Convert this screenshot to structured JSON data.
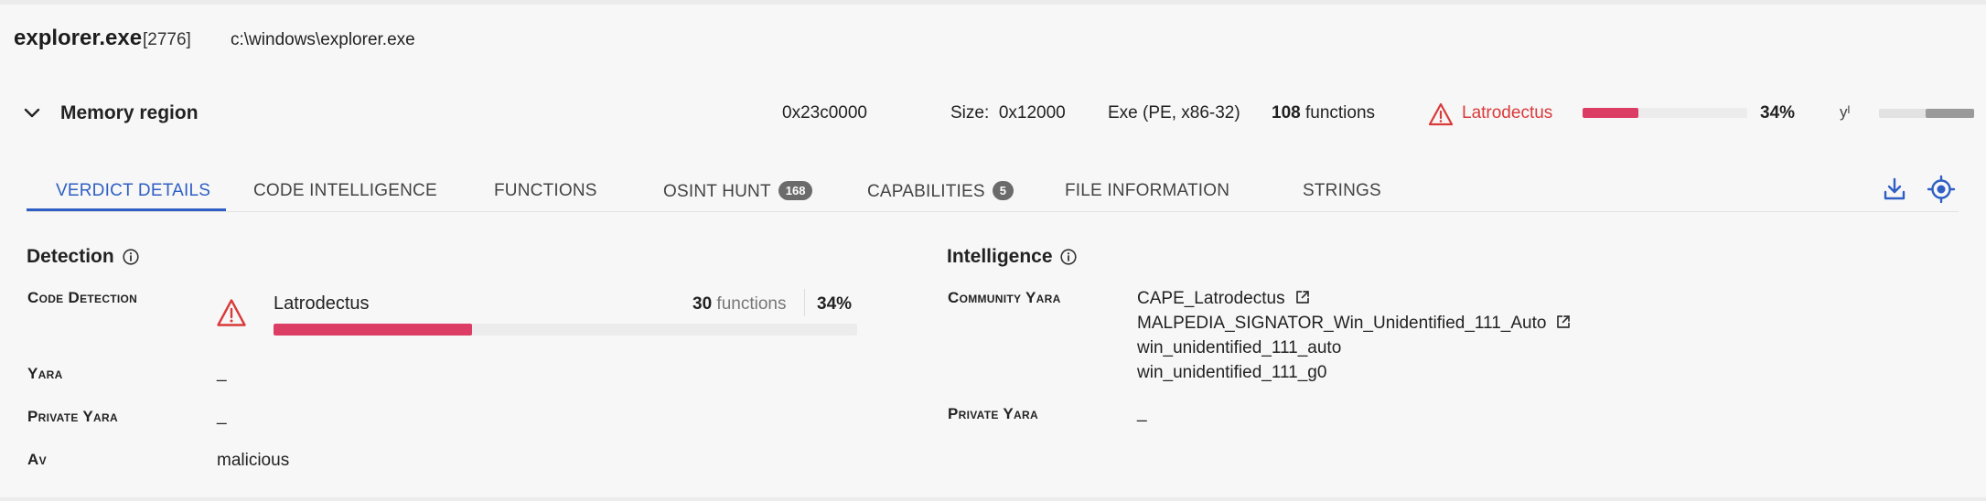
{
  "process": {
    "name": "explorer.exe",
    "pid": "[2776]",
    "path": "c:\\windows\\explorer.exe"
  },
  "memory_region": {
    "title": "Memory region",
    "address": "0x23c0000",
    "size_label": "Size:",
    "size_value": "0x12000",
    "type": "Exe (PE, x86-32)",
    "functions_count": "108",
    "functions_label": "functions",
    "family": "Latrodectus",
    "match_percent_label": "34%",
    "match_fraction": 0.34,
    "entropy_symbol": "yᴵ",
    "entropy_fraction": 0.51
  },
  "tabs": [
    {
      "label": "VERDICT DETAILS",
      "active": true
    },
    {
      "label": "CODE INTELLIGENCE"
    },
    {
      "label": "FUNCTIONS"
    },
    {
      "label": "OSINT HUNT",
      "badge": "168"
    },
    {
      "label": "CAPABILITIES",
      "badge": "5"
    },
    {
      "label": "FILE INFORMATION"
    },
    {
      "label": "STRINGS"
    }
  ],
  "detection": {
    "title": "Detection",
    "code_detection": {
      "label": "Code Detection",
      "family": "Latrodectus",
      "functions_count": "30",
      "functions_label": "functions",
      "percent_label": "34%",
      "fraction": 0.34
    },
    "yara": {
      "label": "Yara",
      "value": "_"
    },
    "private_yara": {
      "label": "Private Yara",
      "value": "_"
    },
    "av": {
      "label": "Av",
      "value": "malicious"
    }
  },
  "intelligence": {
    "title": "Intelligence",
    "community_yara": {
      "label": "Community Yara",
      "rules": [
        "CAPE_Latrodectus",
        "MALPEDIA_SIGNATOR_Win_Unidentified_111_Auto",
        "win_unidentified_111_auto",
        "win_unidentified_111_g0"
      ]
    },
    "private_yara": {
      "label": "Private Yara",
      "value": "_"
    }
  },
  "colors": {
    "accent": "#2f5fc4",
    "danger": "#d93a3a",
    "bar": "#dc3d64",
    "badge": "#6b6b6b"
  },
  "icons": {
    "expand": "chevron-down-icon",
    "warning": "warning-triangle-icon",
    "info": "info-icon",
    "download": "download-icon",
    "locate": "crosshair-icon",
    "external": "external-link-icon"
  }
}
